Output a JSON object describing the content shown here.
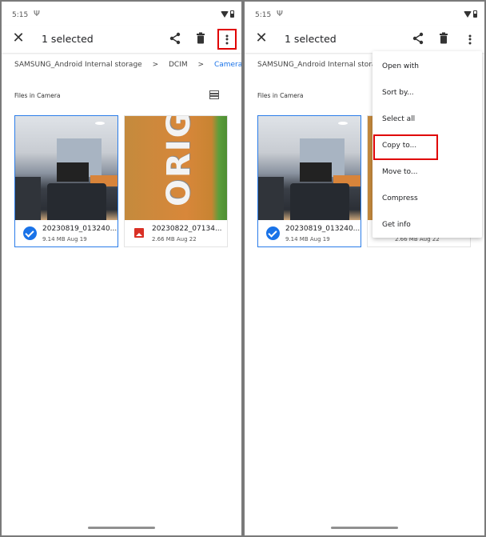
{
  "status_bar": {
    "time": "5:15",
    "usb_icon": "usb-icon",
    "wifi_icon": "wifi-icon",
    "battery_icon": "battery-icon"
  },
  "app_bar": {
    "title": "1 selected",
    "close_icon": "close-icon",
    "share_icon": "share-icon",
    "delete_icon": "delete-icon",
    "more_icon": "more-vert-icon"
  },
  "breadcrumb": {
    "items": [
      "SAMSUNG_Android Internal storage",
      "DCIM",
      "Camera"
    ],
    "separator": ">"
  },
  "section_label": "Files in Camera",
  "files": [
    {
      "name": "20230819_013240...",
      "size": "9.14 MB",
      "date": "Aug 19",
      "selected": true
    },
    {
      "name": "20230822_07134...",
      "size": "2.66 MB",
      "date": "Aug 22",
      "selected": false
    }
  ],
  "thumbnail_text": "ORIGAMI",
  "overflow_menu": {
    "items": [
      "Open with",
      "Sort by...",
      "Select all",
      "Copy to...",
      "Move to...",
      "Compress",
      "Get info"
    ],
    "highlighted": "Copy to..."
  },
  "colors": {
    "accent": "#1a73e8",
    "highlight_box": "#e00000",
    "image_icon": "#d93025"
  }
}
